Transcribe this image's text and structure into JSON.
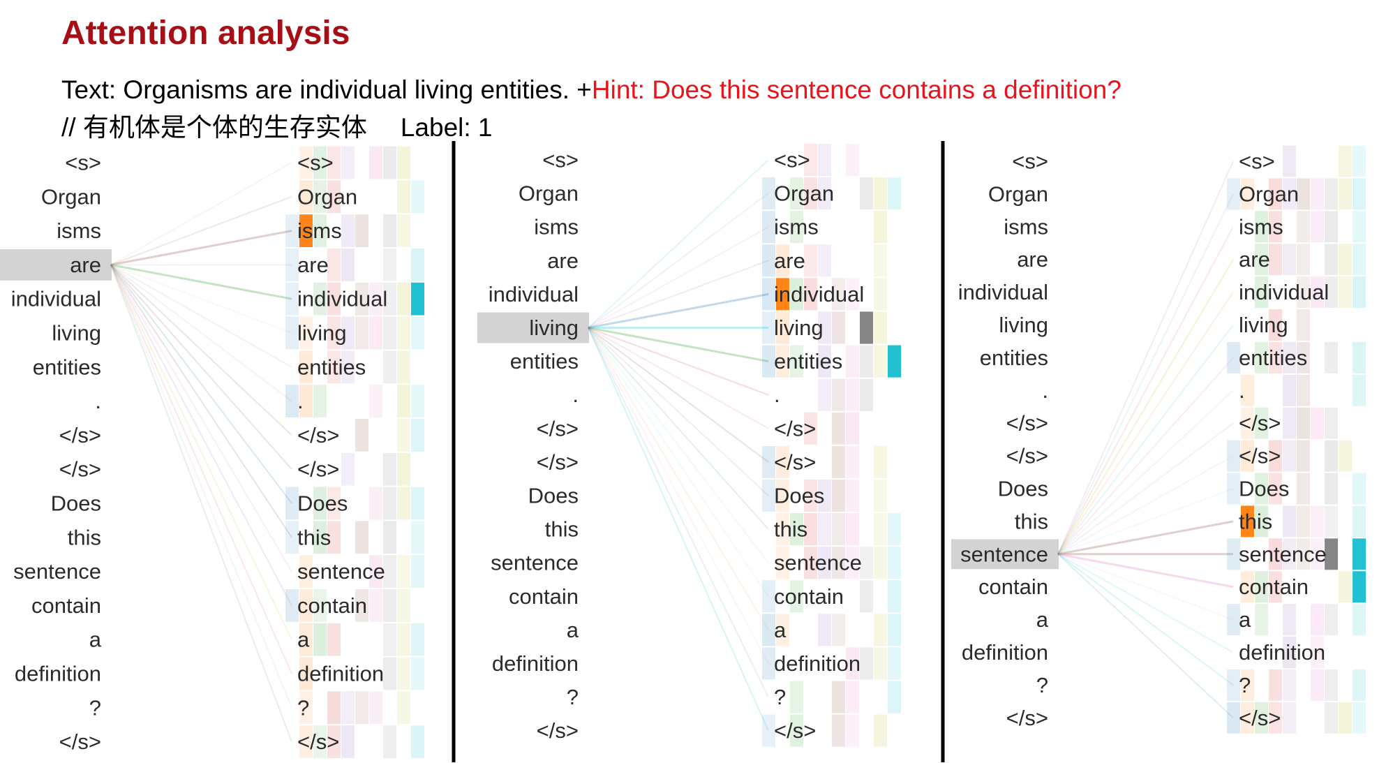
{
  "title": "Attention analysis",
  "text_prefix": "Text: Organisms are individual living entities. +",
  "hint": "Hint: Does this sentence contains a definition?",
  "translation": "// 有机体是个体的生存实体",
  "label": "Label: 1",
  "colors": {
    "title": "#a50f15",
    "hint": "#e8141c",
    "selected_token_bg": "#d3d3d3",
    "separator": "#000000",
    "head_palette": [
      "#1f77b4",
      "#ff7f0e",
      "#2ca02c",
      "#d62728",
      "#9467bd",
      "#8c564b",
      "#e377c2",
      "#7f7f7f",
      "#bcbd22",
      "#17becf"
    ]
  },
  "panels": [
    {
      "left_tokens": [
        "<s>",
        "Organ",
        "isms",
        "are",
        "individual",
        "living",
        "entities",
        ".",
        "</s>",
        "</s>",
        "Does",
        "this",
        "sentence",
        "contain",
        "a",
        "definition",
        "?",
        "</s>"
      ],
      "right_tokens": [
        "<s>",
        "Organ",
        "isms",
        "are",
        "individual",
        "living",
        "entities",
        ".",
        "</s>",
        "</s>",
        "Does",
        "this",
        "sentence",
        "contain",
        "a",
        "definition",
        "?",
        "</s>"
      ],
      "selected": "are",
      "strong_heads": [
        {
          "token": "isms",
          "head": 1
        },
        {
          "token": "individual",
          "head": 9
        }
      ]
    },
    {
      "left_tokens": [
        "<s>",
        "Organ",
        "isms",
        "are",
        "individual",
        "living",
        "entities",
        ".",
        "</s>",
        "</s>",
        "Does",
        "this",
        "sentence",
        "contain",
        "a",
        "definition",
        "?",
        "</s>"
      ],
      "right_tokens": [
        "<s>",
        "Organ",
        "isms",
        "are",
        "individual",
        "living",
        "entities",
        ".",
        "</s>",
        "</s>",
        "Does",
        "this",
        "sentence",
        "contain",
        "a",
        "definition",
        "?",
        "</s>"
      ],
      "selected": "living",
      "strong_heads": [
        {
          "token": "individual",
          "head": 1
        },
        {
          "token": "living",
          "head": 7
        },
        {
          "token": "entities",
          "head": 9
        }
      ]
    },
    {
      "left_tokens": [
        "<s>",
        "Organ",
        "isms",
        "are",
        "individual",
        "living",
        "entities",
        ".",
        "</s>",
        "</s>",
        "Does",
        "this",
        "sentence",
        "contain",
        "a",
        "definition",
        "?",
        "</s>"
      ],
      "right_tokens": [
        "<s>",
        "Organ",
        "isms",
        "are",
        "individual",
        "living",
        "entities",
        ".",
        "</s>",
        "</s>",
        "Does",
        "this",
        "sentence",
        "contain",
        "a",
        "definition",
        "?",
        "</s>"
      ],
      "selected": "sentence",
      "strong_heads": [
        {
          "token": "this",
          "head": 1
        },
        {
          "token": "sentence",
          "head": 7
        },
        {
          "token": "sentence",
          "head": 9
        },
        {
          "token": "contain",
          "head": 9
        }
      ]
    }
  ]
}
